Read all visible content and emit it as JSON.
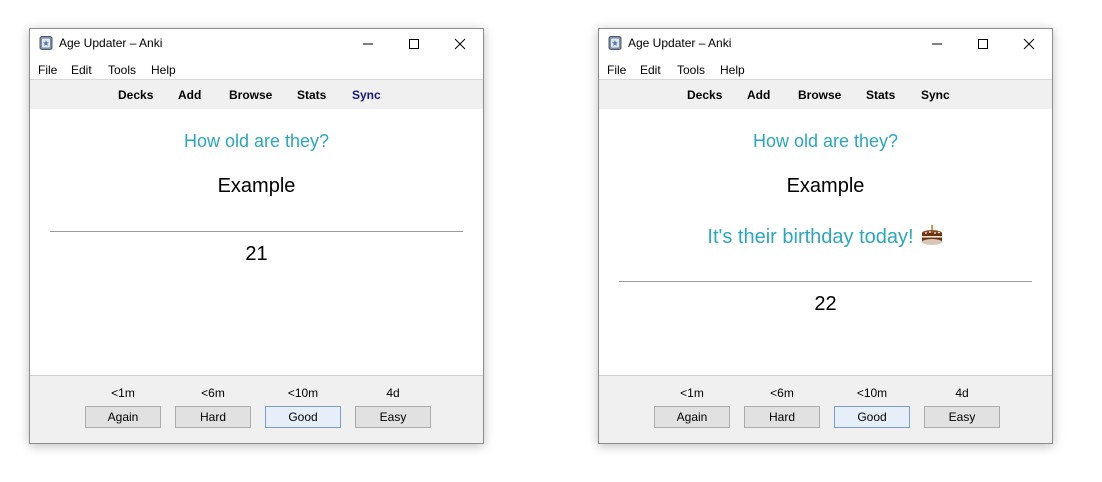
{
  "windows": [
    {
      "title": "Age Updater – Anki",
      "menu": [
        "File",
        "Edit",
        "Tools",
        "Help"
      ],
      "toolbar": [
        "Decks",
        "Add",
        "Browse",
        "Stats",
        "Sync"
      ],
      "card": {
        "prompt": "How old are they?",
        "word": "Example",
        "answer": "21"
      },
      "intervals": [
        "<1m",
        "<6m",
        "<10m",
        "4d"
      ],
      "buttons": [
        "Again",
        "Hard",
        "Good",
        "Easy"
      ]
    },
    {
      "title": "Age Updater – Anki",
      "menu": [
        "File",
        "Edit",
        "Tools",
        "Help"
      ],
      "toolbar": [
        "Decks",
        "Add",
        "Browse",
        "Stats",
        "Sync"
      ],
      "card": {
        "prompt": "How old are they?",
        "word": "Example",
        "birthday": "It's their birthday today!",
        "birthday_icon": "cake-icon",
        "answer": "22"
      },
      "intervals": [
        "<1m",
        "<6m",
        "<10m",
        "4d"
      ],
      "buttons": [
        "Again",
        "Hard",
        "Good",
        "Easy"
      ]
    }
  ],
  "colors": {
    "prompt": "#2aa7bf",
    "sync_active": "#18187a",
    "toolbar_bg": "#f0f0f0"
  }
}
